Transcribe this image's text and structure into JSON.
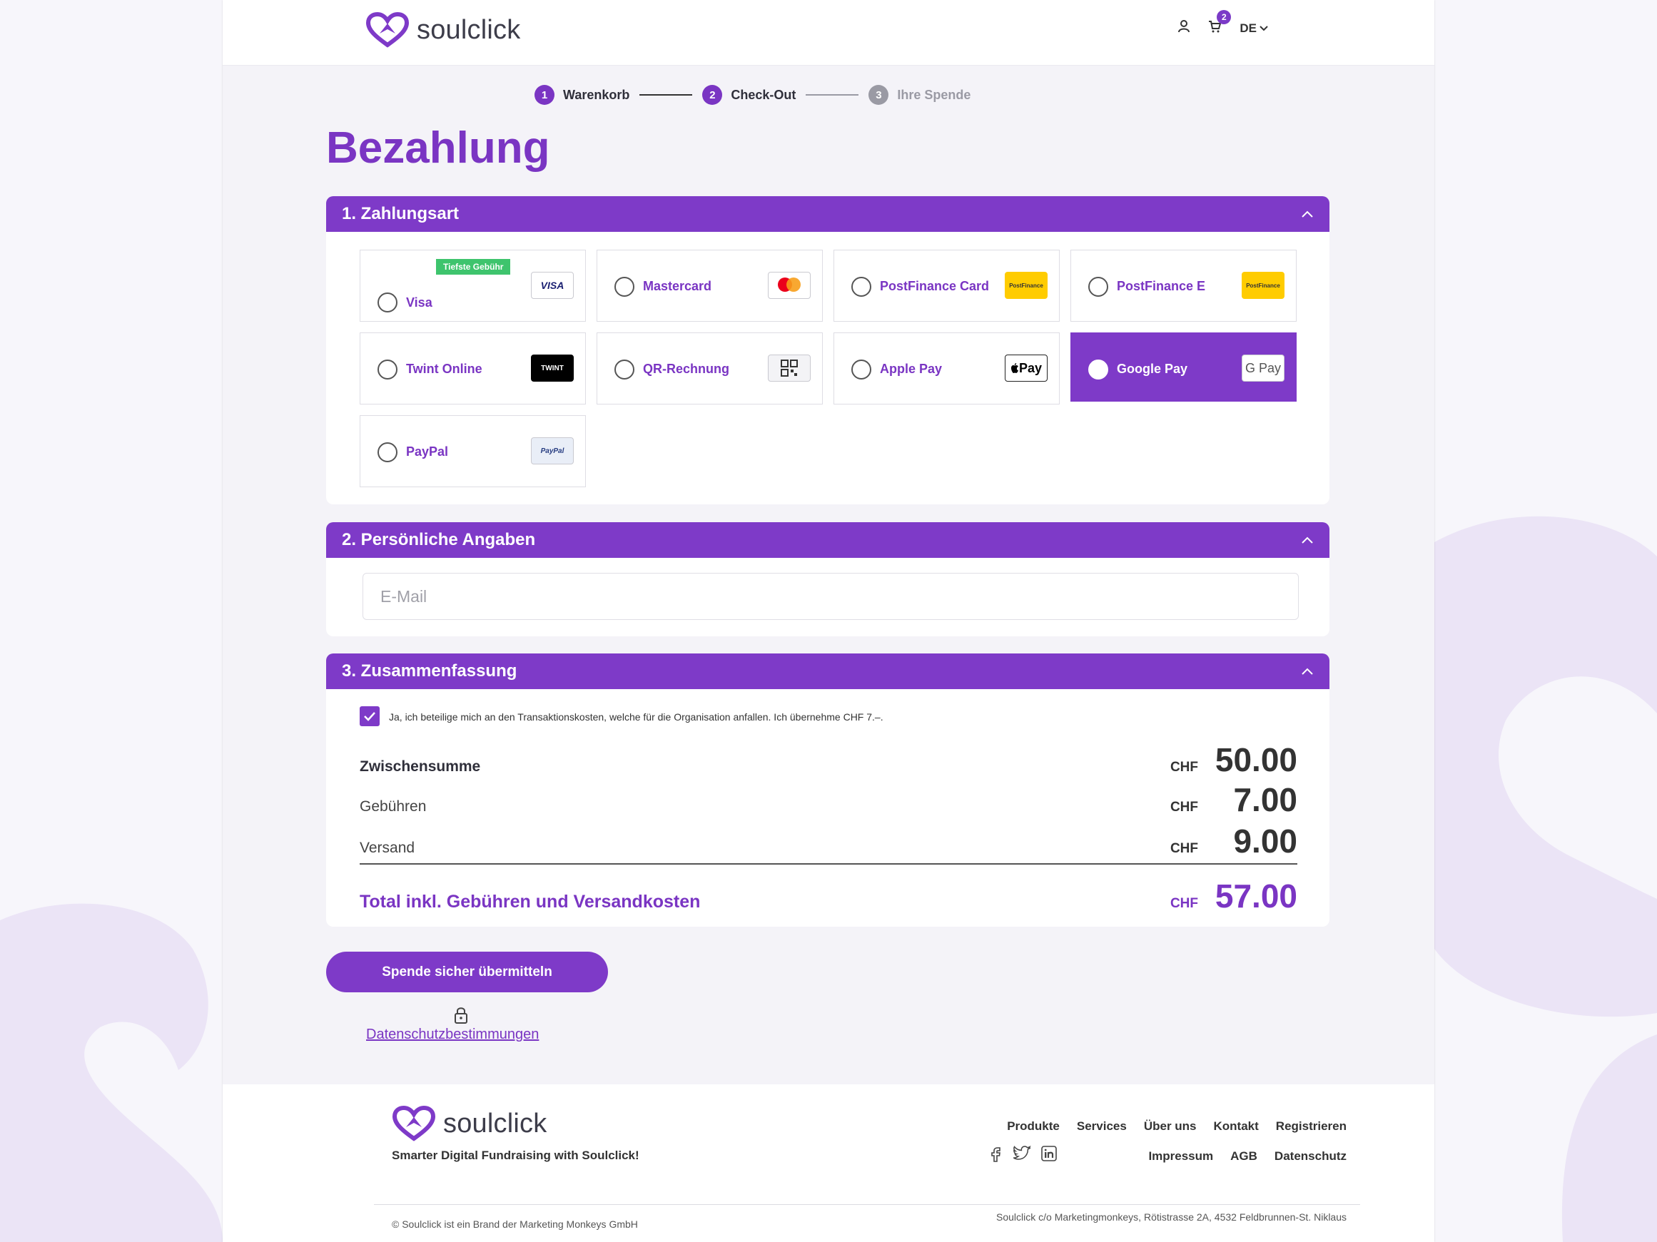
{
  "brand": {
    "name": "soulclick",
    "accent": "#7e3ac8"
  },
  "header": {
    "cart_count": "2",
    "language": "DE"
  },
  "steps": [
    {
      "num": "1",
      "label": "Warenkorb",
      "state": "done"
    },
    {
      "num": "2",
      "label": "Check-Out",
      "state": "active"
    },
    {
      "num": "3",
      "label": "Ihre Spende",
      "state": "inactive"
    }
  ],
  "page_title": "Bezahlung",
  "sections": {
    "payment": {
      "title": "1. Zahlungsart"
    },
    "personal": {
      "title": "2. Persönliche Angaben"
    },
    "summary": {
      "title": "3. Zusammenfassung"
    }
  },
  "payment_methods": [
    {
      "label": "Visa",
      "logo": "VISA",
      "tag": "Tiefste Gebühr",
      "selected": false
    },
    {
      "label": "Mastercard",
      "logo": "mastercard",
      "selected": false
    },
    {
      "label": "PostFinance Card",
      "logo": "PostFinance",
      "selected": false
    },
    {
      "label": "PostFinance E",
      "logo": "PostFinance",
      "selected": false
    },
    {
      "label": "Twint Online",
      "logo": "TWINT",
      "selected": false
    },
    {
      "label": "QR-Rechnung",
      "logo": "qr-code",
      "selected": false
    },
    {
      "label": "Apple Pay",
      "logo": "Pay",
      "selected": false
    },
    {
      "label": "Google Pay",
      "logo": "G Pay",
      "selected": true
    },
    {
      "label": "PayPal",
      "logo": "PayPal",
      "selected": false
    }
  ],
  "personal": {
    "email_placeholder": "E-Mail"
  },
  "summary": {
    "consent_text": "Ja, ich beteilige mich an den Transaktionskosten, welche für die Organisation anfallen. Ich übernehme CHF 7.–.",
    "consent_checked": true,
    "currency": "CHF",
    "subtotal_label": "Zwischensumme",
    "subtotal": "50.00",
    "fees_label": "Gebühren",
    "fees": "7.00",
    "shipping_label": "Versand",
    "shipping": "9.00",
    "total_label": "Total inkl. Gebühren und Versandkosten",
    "total": "57.00"
  },
  "submit_label": "Spende sicher übermitteln",
  "privacy_label": "Datenschutzbestimmungen",
  "footer": {
    "tagline": "Smarter Digital Fundraising with Soulclick!",
    "nav_top": [
      "Produkte",
      "Services",
      "Über uns",
      "Kontakt",
      "Registrieren"
    ],
    "nav_bottom": [
      "Impressum",
      "AGB",
      "Datenschutz"
    ],
    "copyright": "© Soulclick ist ein Brand der Marketing Monkeys GmbH",
    "address": "Soulclick c/o Marketingmonkeys, Rötistrasse 2A, 4532 Feldbrunnen-St. Niklaus"
  }
}
